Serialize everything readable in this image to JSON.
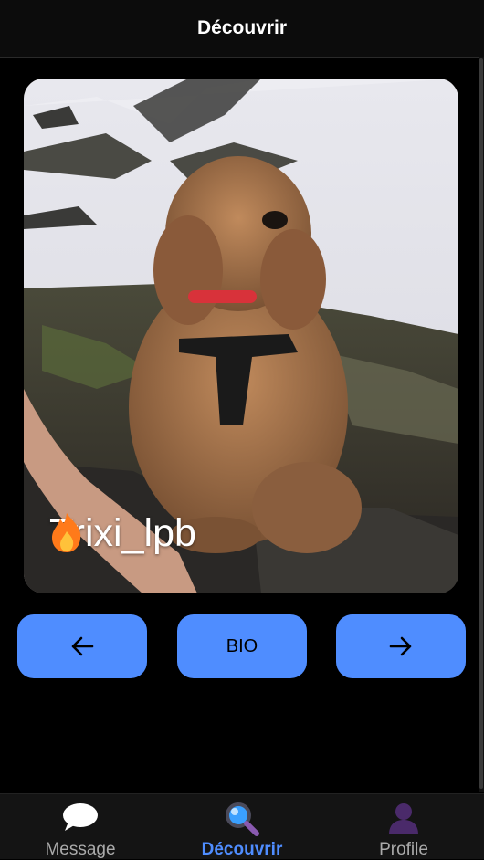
{
  "header": {
    "title": "Découvrir"
  },
  "profile_card": {
    "name": "Trixi_lpb",
    "badge_icon": "fire-icon",
    "photo": "curly brown poodle dog sitting on rocky snowy mountain with red collar and black harness"
  },
  "actions": {
    "prev_icon": "arrow-left-icon",
    "bio_label": "BIO",
    "next_icon": "arrow-right-icon"
  },
  "tabs": [
    {
      "label": "Message",
      "icon": "speech-bubble-icon",
      "active": false
    },
    {
      "label": "Découvrir",
      "icon": "magnifier-icon",
      "active": true
    },
    {
      "label": "Profile",
      "icon": "person-icon",
      "active": false
    }
  ],
  "colors": {
    "accent": "#4f8dff",
    "background": "#000000",
    "header_bg": "#0c0c0c",
    "tabbar_bg": "#141414"
  }
}
